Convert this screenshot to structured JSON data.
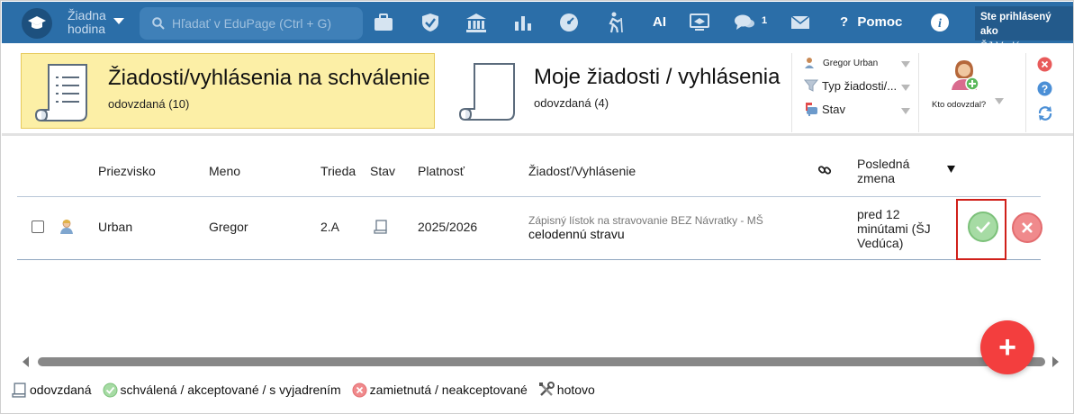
{
  "topbar": {
    "hour_select": [
      "Žiadna",
      "hodina"
    ],
    "search_placeholder": "Hľadať v EduPage (Ctrl + G)",
    "ai_label": "AI",
    "messages_count": "1",
    "help_label": "Pomoc",
    "logged_in_label": "Ste prihlásený ako",
    "logged_in_user": "ŠJ Vedúca",
    "colors": {
      "bar": "#2b6ea8",
      "search_bg": "#3f80b8"
    }
  },
  "header": {
    "cards": [
      {
        "title": "Žiadosti/vyhlásenia na schválenie",
        "subtitle": "odovzdaná (10)",
        "active": true
      },
      {
        "title": "Moje žiadosti / vyhlásenia",
        "subtitle": "odovzdaná (4)",
        "active": false
      }
    ],
    "filters": {
      "person": "Gregor Urban",
      "type": "Typ žiadosti/...",
      "status": "Stav"
    },
    "submitted_by_label": "Kto odovzdal?",
    "colors": {
      "active_card": "#fcefa6"
    }
  },
  "table": {
    "columns": {
      "surname": "Priezvisko",
      "name": "Meno",
      "class": "Trieda",
      "status": "Stav",
      "validity": "Platnosť",
      "request": "Žiadosť/Vyhlásenie",
      "last_change": [
        "Posledná",
        "zmena"
      ]
    },
    "rows": [
      {
        "surname": "Urban",
        "name": "Gregor",
        "class": "2.A",
        "validity": "2025/2026",
        "request_hint": "Zápisný lístok na stravovanie BEZ Návratky - MŠ",
        "request_main": "celodennú stravu",
        "last_change": [
          "pred 12",
          "minútami (ŠJ",
          "Vedúca)"
        ]
      }
    ]
  },
  "fab": {
    "label": "+"
  },
  "legend": [
    {
      "icon": "document-icon",
      "label": "odovzdaná"
    },
    {
      "icon": "check-circle-icon",
      "label": "schválená / akceptované / s vyjadrením"
    },
    {
      "icon": "x-circle-icon",
      "label": "zamietnutá / neakceptované"
    },
    {
      "icon": "tools-icon",
      "label": "hotovo"
    }
  ]
}
